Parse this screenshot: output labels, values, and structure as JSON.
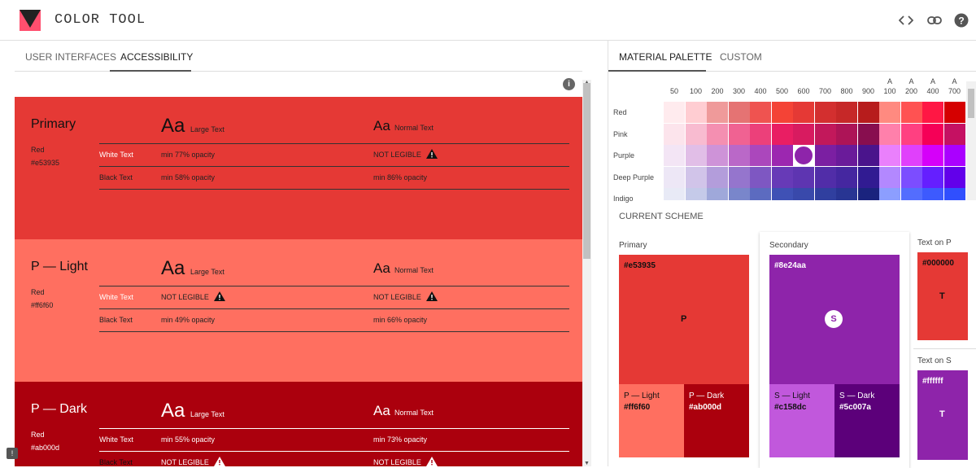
{
  "app": {
    "title": "COLOR TOOL"
  },
  "top_icons": [
    "code-icon",
    "link-icon",
    "help-icon"
  ],
  "left_tabs": [
    {
      "label": "USER INTERFACES"
    },
    {
      "label": "ACCESSIBILITY",
      "active": true
    }
  ],
  "right_tabs": [
    {
      "label": "MATERIAL PALETTE",
      "active": true
    },
    {
      "label": "CUSTOM"
    }
  ],
  "accessibility": {
    "large_text_label": "Large Text",
    "normal_text_label": "Normal Text",
    "aa": "Aa",
    "white_text": "White Text",
    "black_text": "Black Text",
    "blocks": [
      {
        "title": "Primary",
        "family": "Red",
        "hex": "#e53935",
        "color": "#e53935",
        "white_large": "min 77% opacity",
        "white_normal": "NOT LEGIBLE",
        "black_large": "min 58% opacity",
        "black_normal": "min 86% opacity"
      },
      {
        "title": "P — Light",
        "family": "Red",
        "hex": "#ff6f60",
        "color": "#ff6f60",
        "white_large": "NOT LEGIBLE",
        "white_normal": "NOT LEGIBLE",
        "black_large": "min 49% opacity",
        "black_normal": "min 66% opacity"
      },
      {
        "title": "P — Dark",
        "family": "Red",
        "hex": "#ab000d",
        "color": "#ab000d",
        "white_large": "min 55% opacity",
        "white_normal": "min 73% opacity",
        "black_large": "NOT LEGIBLE",
        "black_normal": "NOT LEGIBLE"
      }
    ]
  },
  "palette": {
    "shades": [
      "50",
      "100",
      "200",
      "300",
      "400",
      "500",
      "600",
      "700",
      "800",
      "900"
    ],
    "accent_prefix": "A",
    "accents": [
      "100",
      "200",
      "400",
      "700"
    ],
    "rows": [
      {
        "name": "Red",
        "colors": [
          "#ffebee",
          "#ffcdd2",
          "#ef9a9a",
          "#e57373",
          "#ef5350",
          "#f44336",
          "#e53935",
          "#d32f2f",
          "#c62828",
          "#b71c1c",
          "#ff8a80",
          "#ff5252",
          "#ff1744",
          "#d50000"
        ]
      },
      {
        "name": "Pink",
        "colors": [
          "#fce4ec",
          "#f8bbd0",
          "#f48fb1",
          "#f06292",
          "#ec407a",
          "#e91e63",
          "#d81b60",
          "#c2185b",
          "#ad1457",
          "#880e4f",
          "#ff80ab",
          "#ff4081",
          "#f50057",
          "#c51162"
        ]
      },
      {
        "name": "Purple",
        "colors": [
          "#f3e5f5",
          "#e1bee7",
          "#ce93d8",
          "#ba68c8",
          "#ab47bc",
          "#9c27b0",
          "#8e24aa",
          "#7b1fa2",
          "#6a1b9a",
          "#4a148c",
          "#ea80fc",
          "#e040fb",
          "#d500f9",
          "#aa00ff"
        ]
      },
      {
        "name": "Deep Purple",
        "colors": [
          "#ede7f6",
          "#d1c4e9",
          "#b39ddb",
          "#9575cd",
          "#7e57c2",
          "#673ab7",
          "#5e35b1",
          "#512da8",
          "#4527a0",
          "#311b92",
          "#b388ff",
          "#7c4dff",
          "#651fff",
          "#6200ea"
        ]
      },
      {
        "name": "Indigo",
        "colors": [
          "#e8eaf6",
          "#c5cae9",
          "#9fa8da",
          "#7986cb",
          "#5c6bc0",
          "#3f51b5",
          "#3949ab",
          "#303f9f",
          "#283593",
          "#1a237e",
          "#8c9eff",
          "#536dfe",
          "#3d5afe",
          "#304ffe"
        ]
      }
    ]
  },
  "scheme": {
    "label": "CURRENT SCHEME",
    "primary": {
      "title": "Primary",
      "hex": "#e53935",
      "letter": "P",
      "light": {
        "name": "P — Light",
        "hex": "#ff6f60"
      },
      "dark": {
        "name": "P — Dark",
        "hex": "#ab000d"
      }
    },
    "secondary": {
      "title": "Secondary",
      "hex": "#8e24aa",
      "letter": "S",
      "light": {
        "name": "S — Light",
        "hex": "#c158dc"
      },
      "dark": {
        "name": "S — Dark",
        "hex": "#5c007a"
      }
    },
    "text_on_p": {
      "title": "Text on P",
      "hex": "#000000",
      "letter": "T"
    },
    "text_on_s": {
      "title": "Text on S",
      "hex": "#ffffff",
      "letter": "T"
    }
  }
}
